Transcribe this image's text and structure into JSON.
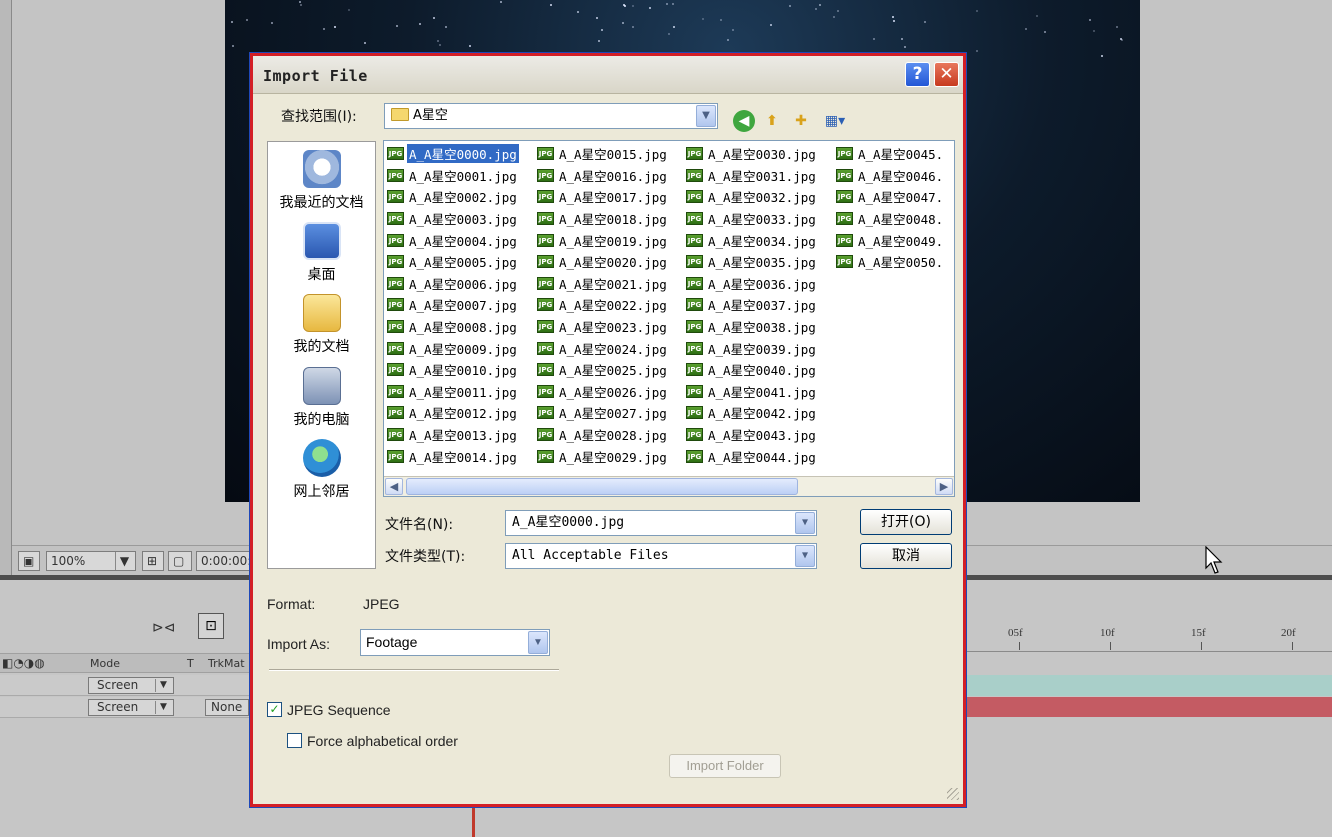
{
  "background_app": {
    "zoom": "100%",
    "timecode": "0:00:00:",
    "column_mode": "Mode",
    "column_t": "T",
    "column_trkmat": "TrkMat",
    "rows": [
      {
        "mode": "Screen",
        "trkmat": ""
      },
      {
        "mode": "Screen",
        "trkmat": "None"
      }
    ],
    "ruler_ticks": [
      "05f",
      "10f",
      "15f",
      "20f"
    ]
  },
  "dialog": {
    "title": "Import File",
    "help_glyph": "?",
    "close_glyph": "✕",
    "lookin_label": "查找范围(I):",
    "lookin_value": "A星空",
    "places": [
      {
        "label": "我最近的文档",
        "icon": "recent-documents-icon"
      },
      {
        "label": "桌面",
        "icon": "desktop-icon"
      },
      {
        "label": "我的文档",
        "icon": "my-documents-icon"
      },
      {
        "label": "我的电脑",
        "icon": "my-computer-icon"
      },
      {
        "label": "网上邻居",
        "icon": "network-places-icon"
      }
    ],
    "files": {
      "col1": [
        "A_A星空0000.jpg",
        "A_A星空0001.jpg",
        "A_A星空0002.jpg",
        "A_A星空0003.jpg",
        "A_A星空0004.jpg",
        "A_A星空0005.jpg",
        "A_A星空0006.jpg",
        "A_A星空0007.jpg",
        "A_A星空0008.jpg",
        "A_A星空0009.jpg",
        "A_A星空0010.jpg",
        "A_A星空0011.jpg",
        "A_A星空0012.jpg",
        "A_A星空0013.jpg",
        "A_A星空0014.jpg"
      ],
      "col2": [
        "A_A星空0015.jpg",
        "A_A星空0016.jpg",
        "A_A星空0017.jpg",
        "A_A星空0018.jpg",
        "A_A星空0019.jpg",
        "A_A星空0020.jpg",
        "A_A星空0021.jpg",
        "A_A星空0022.jpg",
        "A_A星空0023.jpg",
        "A_A星空0024.jpg",
        "A_A星空0025.jpg",
        "A_A星空0026.jpg",
        "A_A星空0027.jpg",
        "A_A星空0028.jpg",
        "A_A星空0029.jpg"
      ],
      "col3": [
        "A_A星空0030.jpg",
        "A_A星空0031.jpg",
        "A_A星空0032.jpg",
        "A_A星空0033.jpg",
        "A_A星空0034.jpg",
        "A_A星空0035.jpg",
        "A_A星空0036.jpg",
        "A_A星空0037.jpg",
        "A_A星空0038.jpg",
        "A_A星空0039.jpg",
        "A_A星空0040.jpg",
        "A_A星空0041.jpg",
        "A_A星空0042.jpg",
        "A_A星空0043.jpg",
        "A_A星空0044.jpg"
      ],
      "col4": [
        "A_A星空0045.",
        "A_A星空0046.",
        "A_A星空0047.",
        "A_A星空0048.",
        "A_A星空0049.",
        "A_A星空0050."
      ],
      "selected": "A_A星空0000.jpg",
      "file_badge": "JPG"
    },
    "filename_label": "文件名(N):",
    "filename_value": "A_A星空0000.jpg",
    "filetype_label": "文件类型(T):",
    "filetype_value": "All Acceptable Files",
    "open_button": "打开(O)",
    "cancel_button": "取消",
    "format_label": "Format:",
    "format_value": "JPEG",
    "import_as_label": "Import As:",
    "import_as_value": "Footage",
    "jpeg_sequence_label": "JPEG Sequence",
    "jpeg_sequence_checked": true,
    "force_alpha_label": "Force alphabetical order",
    "force_alpha_checked": false,
    "import_folder_button": "Import Folder"
  }
}
